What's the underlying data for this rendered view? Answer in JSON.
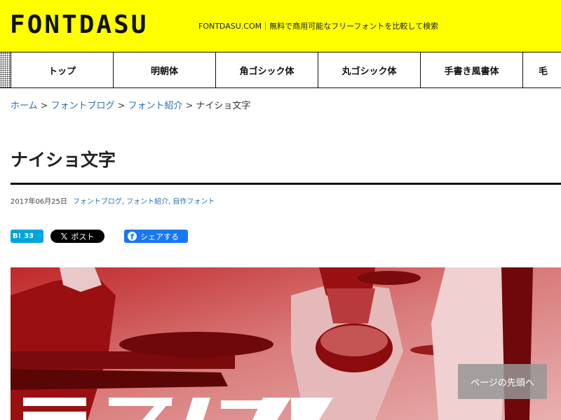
{
  "site": {
    "logo": "FONTDASU",
    "tagline": "FONTDASU.COM｜無料で商用可能なフリーフォントを比較して検索"
  },
  "nav": {
    "items": [
      {
        "label": "トップ"
      },
      {
        "label": "明朝体"
      },
      {
        "label": "角ゴシック体"
      },
      {
        "label": "丸ゴシック体"
      },
      {
        "label": "手書き風書体"
      },
      {
        "label": "毛"
      }
    ]
  },
  "breadcrumb": {
    "items": [
      {
        "label": "ホーム"
      },
      {
        "label": "フォントブログ"
      },
      {
        "label": "フォント紹介"
      }
    ],
    "separator": ">",
    "current": "ナイショ文字"
  },
  "article": {
    "title": "ナイショ文字",
    "date": "2017年06月25日",
    "categories": [
      "フォントブログ",
      "フォント紹介",
      "自作フォント"
    ],
    "category_separator": ","
  },
  "social": {
    "hatena_logo": "B!",
    "hatena_count": "33",
    "x_logo": "𝕏",
    "x_label": "ポスト",
    "fb_logo": "f",
    "fb_label": "シェアする"
  },
  "back_to_top": "ページの先頭へ",
  "colors": {
    "header_bg": "#ffff00",
    "link": "#2a6fb5",
    "hatena": "#00a4de",
    "facebook": "#1877f2",
    "hero_red": "#b01e1e"
  },
  "icons": {
    "hatena": "hatena-bookmark-icon",
    "x": "x-logo-icon",
    "facebook": "facebook-icon"
  }
}
